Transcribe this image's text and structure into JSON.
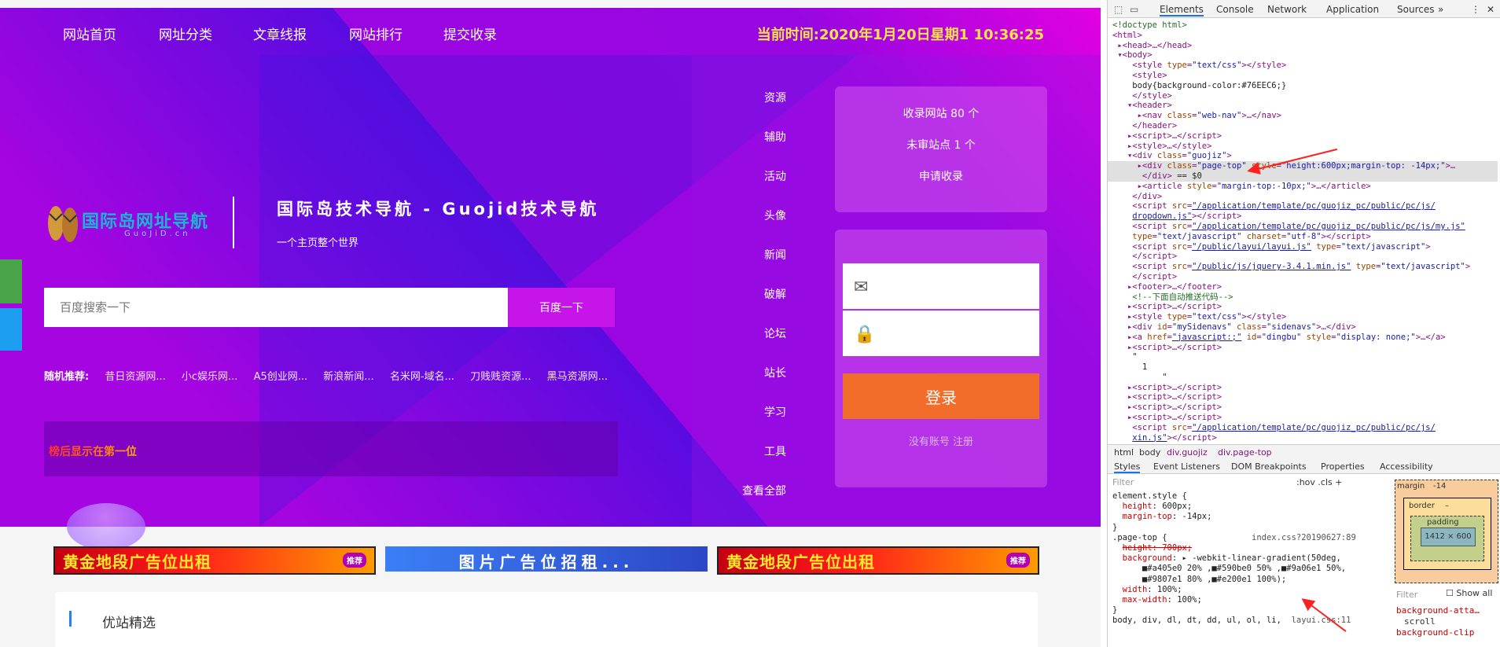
{
  "nav": {
    "items": [
      "网站首页",
      "网址分类",
      "文章线报",
      "网站排行",
      "提交收录"
    ],
    "time": "当前时间:2020年1月20日星期1 10:36:25"
  },
  "logo": {
    "text": "国际岛网址导航",
    "sub": "GuoJiD.cn"
  },
  "site": {
    "title": "国际岛技术导航 - Guojid技术导航",
    "subtitle": "一个主页整个世界"
  },
  "search": {
    "placeholder": "百度搜索一下",
    "button": "百度一下"
  },
  "random": {
    "label": "随机推荐:",
    "links": [
      "昔日资源网...",
      "小c娱乐网...",
      "A5创业网...",
      "新浪新闻...",
      "名米网-域名...",
      "刀贱贱资源...",
      "黑马资源网..."
    ]
  },
  "notice": "榜后显示在第一位",
  "categories": [
    "资源",
    "辅助",
    "活动",
    "头像",
    "新闻",
    "破解",
    "论坛",
    "站长",
    "学习",
    "工具",
    "查看全部"
  ],
  "stats": {
    "collected": "收录网站 80 个",
    "pending": "未审站点 1 个",
    "submit": "申请收录"
  },
  "login": {
    "button": "登录",
    "register": "没有账号 注册",
    "mail_icon": "mail-icon",
    "lock_icon": "lock-icon"
  },
  "ads": {
    "gold": "黄金地段广告位出租",
    "gold_badge": "推荐",
    "image": "图片广告位招租..."
  },
  "featured": {
    "title": "优站精选"
  },
  "devtools": {
    "tabs": [
      "Elements",
      "Console",
      "Network",
      "Application",
      "Sources",
      "»"
    ],
    "breadcrumb": [
      "html",
      "body",
      "div.guojiz",
      "div.page-top"
    ],
    "style_tabs": [
      "Styles",
      "Event Listeners",
      "DOM Breakpoints",
      "Properties",
      "Accessibility"
    ],
    "filter": "Filter",
    "hov": ":hov  .cls  +",
    "box_margin": "margin",
    "box_margin_value": "-14",
    "box_border": "border",
    "box_border_value": "–",
    "box_padding": "padding",
    "box_content": "1412 × 600",
    "box_filter": "Filter",
    "show_all": "Show all",
    "computed_1": "background-atta…",
    "computed_1_value": "scroll",
    "computed_2": "background-clip",
    "source_1": "index.css?20190627:89",
    "source_2": "layui.css:11",
    "bottom_rule": "body, div, dl, dt, dd, ul, ol, li,"
  }
}
